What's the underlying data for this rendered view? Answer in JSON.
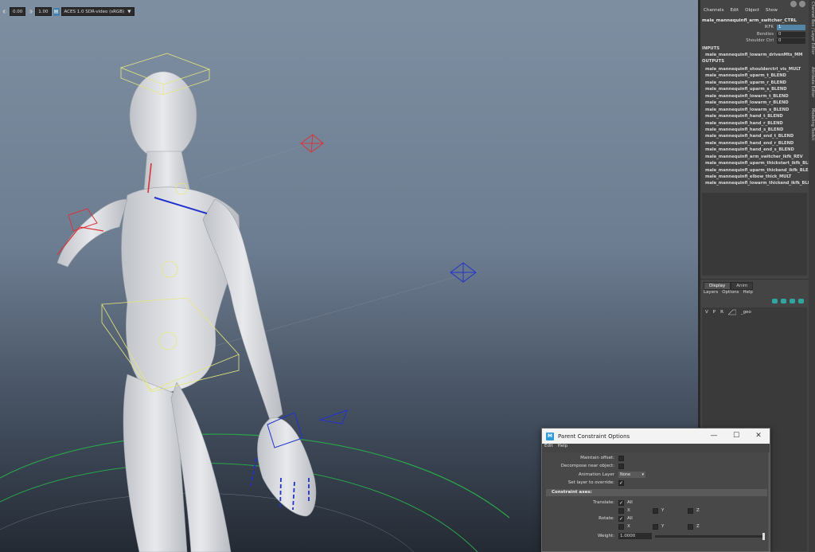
{
  "viewport_toolbar": {
    "field_1": "0.00",
    "field_2": "1.00",
    "colorspace": "ACES 1.0 SDR-video (sRGB)",
    "dropdown_arrow": "▼"
  },
  "channel_box": {
    "menu": [
      "Channels",
      "Edit",
      "Object",
      "Show"
    ],
    "node_name": "male_mannequinfl_arm_switcher_CTRL",
    "attributes": [
      {
        "label": "IKFK",
        "value": "1"
      },
      {
        "label": "Bendies",
        "value": "0"
      },
      {
        "label": "Shoulder Ctrl",
        "value": "0"
      }
    ],
    "inputs_header": "INPUTS",
    "inputs": [
      "male_mannequinfl_lowarm_drivenMts_MM"
    ],
    "outputs_header": "OUTPUTS",
    "outputs": [
      "male_mannequinfl_shoulderctrl_vis_MULT",
      "male_mannequinfl_uparm_t_BLEND",
      "male_mannequinfl_uparm_r_BLEND",
      "male_mannequinfl_uparm_s_BLEND",
      "male_mannequinfl_lowarm_t_BLEND",
      "male_mannequinfl_lowarm_r_BLEND",
      "male_mannequinfl_lowarm_s_BLEND",
      "male_mannequinfl_hand_t_BLEND",
      "male_mannequinfl_hand_r_BLEND",
      "male_mannequinfl_hand_s_BLEND",
      "male_mannequinfl_hand_end_t_BLEND",
      "male_mannequinfl_hand_end_r_BLEND",
      "male_mannequinfl_hand_end_s_BLEND",
      "male_mannequinfl_arm_switcher_ikfk_REV",
      "male_mannequinfl_uparm_thickstart_ikfk_BLEND",
      "male_mannequinfl_uparm_thickend_ikfk_BLEND",
      "male_mannequinfl_elbow_thick_MULT",
      "male_mannequinfl_lowarm_thickend_ikfk_BLEND"
    ]
  },
  "layer_editor": {
    "tabs": [
      "Display",
      "Anim"
    ],
    "menu": [
      "Layers",
      "Options",
      "Help"
    ],
    "layer": {
      "v": "V",
      "p": "P",
      "r": "R",
      "name": "_geo"
    }
  },
  "side_tabs": [
    "Channel Box / Layer Editor",
    "Attribute Editor",
    "Modeling Toolkit"
  ],
  "dialog": {
    "app_icon": "M",
    "title": "Parent Constraint Options",
    "minimize": "—",
    "maximize": "☐",
    "close": "✕",
    "menu": [
      "Edit",
      "Help"
    ],
    "maintain_offset_label": "Maintain offset:",
    "decompose_label": "Decompose near object:",
    "animation_layer_label": "Animation Layer",
    "animation_layer_value": "None",
    "set_layer_label": "Set layer to override:",
    "constraint_axes_header": "Constraint axes:",
    "translate_label": "Translate:",
    "rotate_label": "Rotate:",
    "all_label": "All",
    "x_label": "X",
    "y_label": "Y",
    "z_label": "Z",
    "weight_label": "Weight:",
    "weight_value": "1.0000",
    "check_mark": "✓"
  },
  "colors": {
    "accent": "#5285a6",
    "fk_red": "#d8343a",
    "ik_blue": "#2233cc",
    "ctrl_yellow": "#e6e87a",
    "ground_green": "#2aa64a"
  }
}
